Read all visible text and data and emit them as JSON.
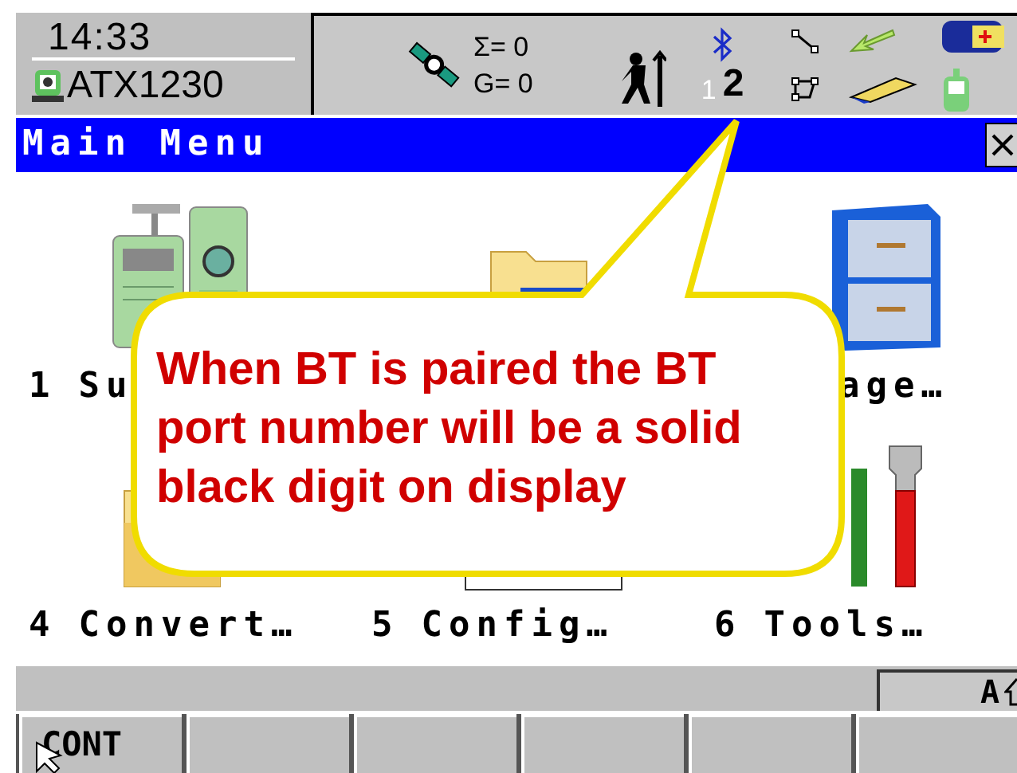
{
  "status": {
    "time": "14:33",
    "instrument": "ATX1230",
    "sats_total": "Σ= 0",
    "sats_glonass": "G= 0",
    "bt_ports": [
      {
        "label": "1",
        "paired": false
      },
      {
        "label": "2",
        "paired": true
      }
    ]
  },
  "title_bar": {
    "title": "Main Menu"
  },
  "menu": [
    {
      "kind": "instruments",
      "number": "1",
      "label": "Su"
    },
    {
      "kind": "folder-window"
    },
    {
      "kind": "cabinet",
      "label": "age…"
    },
    {
      "kind": "folder",
      "number": "4",
      "label": "Convert…"
    },
    {
      "kind": "box",
      "number": "5",
      "label": "Config…"
    },
    {
      "kind": "tools",
      "number": "6",
      "label": "Tools…"
    }
  ],
  "callout": {
    "text": "When BT is paired the BT port number will be a solid black digit on display"
  },
  "input_mode": "A",
  "softkeys": [
    "CONT"
  ]
}
